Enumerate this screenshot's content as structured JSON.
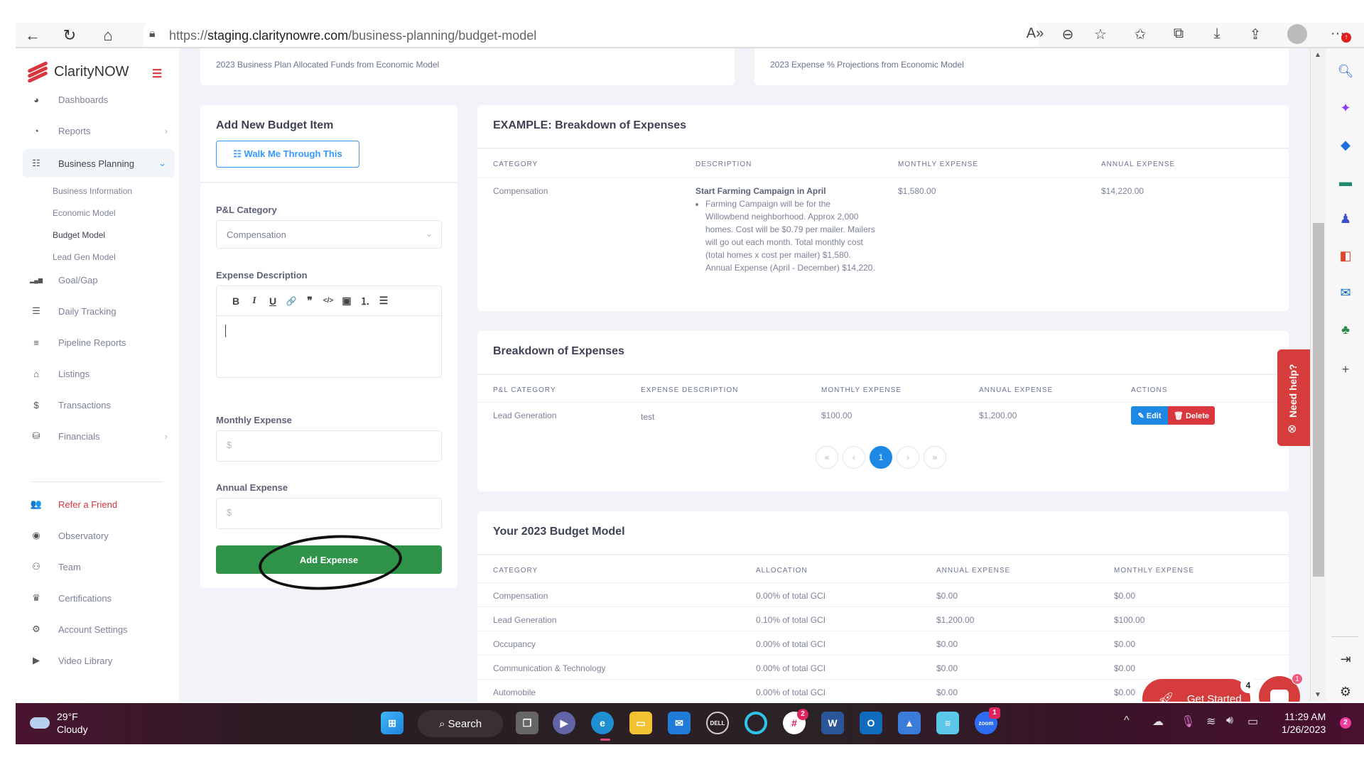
{
  "browser": {
    "url_prefix": "https://",
    "url_host": "staging.claritynowre.com",
    "url_path": "/business-planning/budget-model",
    "icons": [
      "back-icon",
      "refresh-icon",
      "home-icon",
      "lock-icon",
      "read-aloud-icon",
      "zoom-out-icon",
      "add-favorite-icon",
      "favorites-icon",
      "collections-icon",
      "downloads-icon",
      "share-icon",
      "profile-icon",
      "more-icon"
    ]
  },
  "sidebar": {
    "brand": "ClarityNOW",
    "items": [
      {
        "label": "Dashboards",
        "icon": "◕"
      },
      {
        "label": "Reports",
        "icon": "◔",
        "chevron": "›"
      },
      {
        "label": "Business Planning",
        "icon": "☷",
        "chevron": "⌄"
      },
      {
        "label": "Goal/Gap",
        "icon": "▂▄▆"
      },
      {
        "label": "Daily Tracking",
        "icon": "☰"
      },
      {
        "label": "Pipeline Reports",
        "icon": "≡"
      },
      {
        "label": "Listings",
        "icon": "⌂"
      },
      {
        "label": "Transactions",
        "icon": "$"
      },
      {
        "label": "Financials",
        "icon": "⛁",
        "chevron": "›"
      },
      {
        "label": "Refer a Friend",
        "icon": "👥"
      },
      {
        "label": "Observatory",
        "icon": "◉"
      },
      {
        "label": "Team",
        "icon": "⚇"
      },
      {
        "label": "Certifications",
        "icon": "♛"
      },
      {
        "label": "Account Settings",
        "icon": "⚙"
      },
      {
        "label": "Video Library",
        "icon": "▶"
      }
    ],
    "subitems": [
      "Business Information",
      "Economic Model",
      "Budget Model",
      "Lead Gen Model"
    ]
  },
  "top_cards": {
    "left": "2023 Business Plan Allocated Funds from Economic Model",
    "right": "2023 Expense % Projections from Economic Model"
  },
  "add_form": {
    "title": "Add New Budget Item",
    "walk_button": "☷ Walk Me Through This",
    "category_label": "P&L Category",
    "category_value": "Compensation",
    "desc_label": "Expense Description",
    "toolbar": [
      "B",
      "I",
      "U",
      "🔗",
      "❞",
      "</>",
      "▣",
      "⒈",
      "☰"
    ],
    "monthly_label": "Monthly Expense",
    "monthly_placeholder": "$",
    "annual_label": "Annual Expense",
    "annual_placeholder": "$",
    "submit": "Add Expense"
  },
  "example": {
    "title": "EXAMPLE: Breakdown of Expenses",
    "headers": [
      "Category",
      "Description",
      "Monthly Expense",
      "Annual Expense"
    ],
    "row": {
      "category": "Compensation",
      "desc_title": "Start Farming Campaign in April",
      "desc_body": "Farming Campaign will be for the Willowbend neighborhood. Approx 2,000 homes. Cost will be $0.79 per mailer. Mailers will go out each month. Total monthly cost (total homes x cost per mailer) $1,580. Annual Expense (April - December) $14,220.",
      "monthly": "$1,580.00",
      "annual": "$14,220.00"
    }
  },
  "breakdown": {
    "title": "Breakdown of Expenses",
    "headers": [
      "P&L Category",
      "Expense Description",
      "Monthly Expense",
      "Annual Expense",
      "Actions"
    ],
    "rows": [
      {
        "category": "Lead Generation",
        "description": "test",
        "monthly": "$100.00",
        "annual": "$1,200.00"
      }
    ],
    "edit_label": "✎ Edit",
    "delete_label": "🗑 Delete",
    "pagination": {
      "first": "«",
      "prev": "‹",
      "current": "1",
      "next": "›",
      "last": "»"
    }
  },
  "budget_model": {
    "title": "Your 2023 Budget Model",
    "headers": [
      "Category",
      "Allocation",
      "Annual Expense",
      "Monthly Expense"
    ],
    "rows": [
      {
        "category": "Compensation",
        "allocation": "0.00% of total GCI",
        "annual": "$0.00",
        "monthly": "$0.00"
      },
      {
        "category": "Lead Generation",
        "allocation": "0.10% of total GCI",
        "annual": "$1,200.00",
        "monthly": "$100.00"
      },
      {
        "category": "Occupancy",
        "allocation": "0.00% of total GCI",
        "annual": "$0.00",
        "monthly": "$0.00"
      },
      {
        "category": "Communication & Technology",
        "allocation": "0.00% of total GCI",
        "annual": "$0.00",
        "monthly": "$0.00"
      },
      {
        "category": "Automobile",
        "allocation": "0.00% of total GCI",
        "annual": "$0.00",
        "monthly": "$0.00"
      }
    ]
  },
  "floating": {
    "need_help": "Need help?",
    "get_started": "Get Started",
    "get_started_badge": "4",
    "chat_badge": "1"
  },
  "taskbar": {
    "temp": "29°F",
    "weather": "Cloudy",
    "search": "Search",
    "time": "11:29 AM",
    "date": "1/26/2023",
    "notif_count": "2",
    "slack_badge": "2",
    "zoom_badge": "1"
  },
  "colors": {
    "brand_red": "#d9363e",
    "primary_blue": "#3699ff",
    "success_green": "#2f944a"
  }
}
